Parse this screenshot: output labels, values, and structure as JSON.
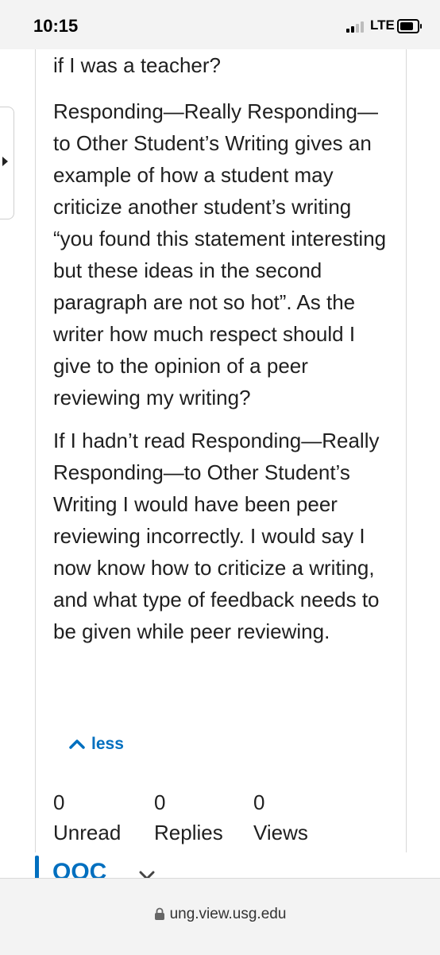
{
  "status_bar": {
    "time": "10:15",
    "network": "LTE"
  },
  "post": {
    "paragraphs": [
      "if I was a teacher?",
      "Responding—Really Responding—to Other Student’s Writing gives an example of how a student may criticize another student’s writing “you found this statement interesting but these ideas in the second paragraph are not so hot”. As the writer how much respect should I give to the opinion of a peer reviewing my writing?",
      "If I hadn’t read Responding—Really Responding—to Other Student’s Writing I would have been peer reviewing incorrectly. I would say I now know how to criticize a writing, and what type of feedback needs to be given while peer reviewing."
    ],
    "less_label": "less"
  },
  "stats": [
    {
      "count": "0",
      "label": "Unread"
    },
    {
      "count": "0",
      "label": "Replies"
    },
    {
      "count": "0",
      "label": "Views"
    }
  ],
  "next_topic": {
    "title": "OOC"
  },
  "browser": {
    "url": "ung.view.usg.edu"
  },
  "colors": {
    "accent": "#006fbf",
    "text": "#1f1f1f",
    "chrome": "#f3f3f3"
  }
}
